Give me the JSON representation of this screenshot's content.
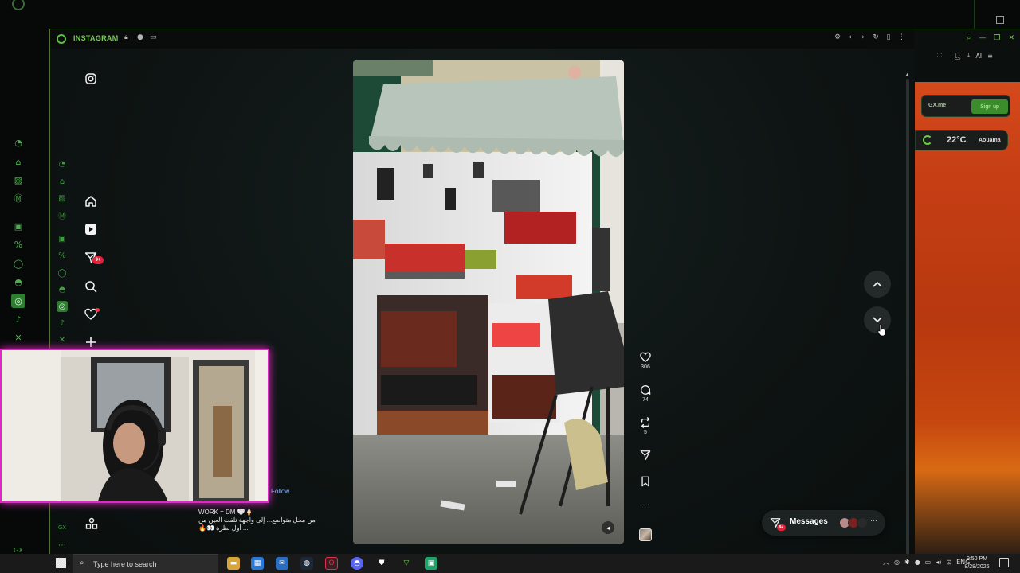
{
  "browser": {
    "tab_title": "INSTAGRAM"
  },
  "instagram": {
    "nav_badge_count": "9+",
    "post": {
      "follow_label": "Follow",
      "caption_line1": "WORK = DM 🤍🍦",
      "caption_line2": "من محل متواضع... إلى واجهة تلفت العين من",
      "caption_line3": "... أول نظرة 👀🔥",
      "likes": "306",
      "comments": "74",
      "reposts": "5"
    },
    "messages": {
      "label": "Messages",
      "badge": "9+"
    }
  },
  "side_panel": {
    "gx_label": "GX.me",
    "signup_label": "Sign up",
    "weather_temp": "22°C",
    "weather_city": "Aouama",
    "ai_label": "AI"
  },
  "taskbar": {
    "search_placeholder": "Type here to search",
    "language": "ENG",
    "time": "9:50 PM",
    "date": "8/28/2026"
  },
  "accent_colors": {
    "gx_green": "#6dcf45",
    "instagram_red": "#e5203b",
    "webcam_border": "#e326c7"
  }
}
